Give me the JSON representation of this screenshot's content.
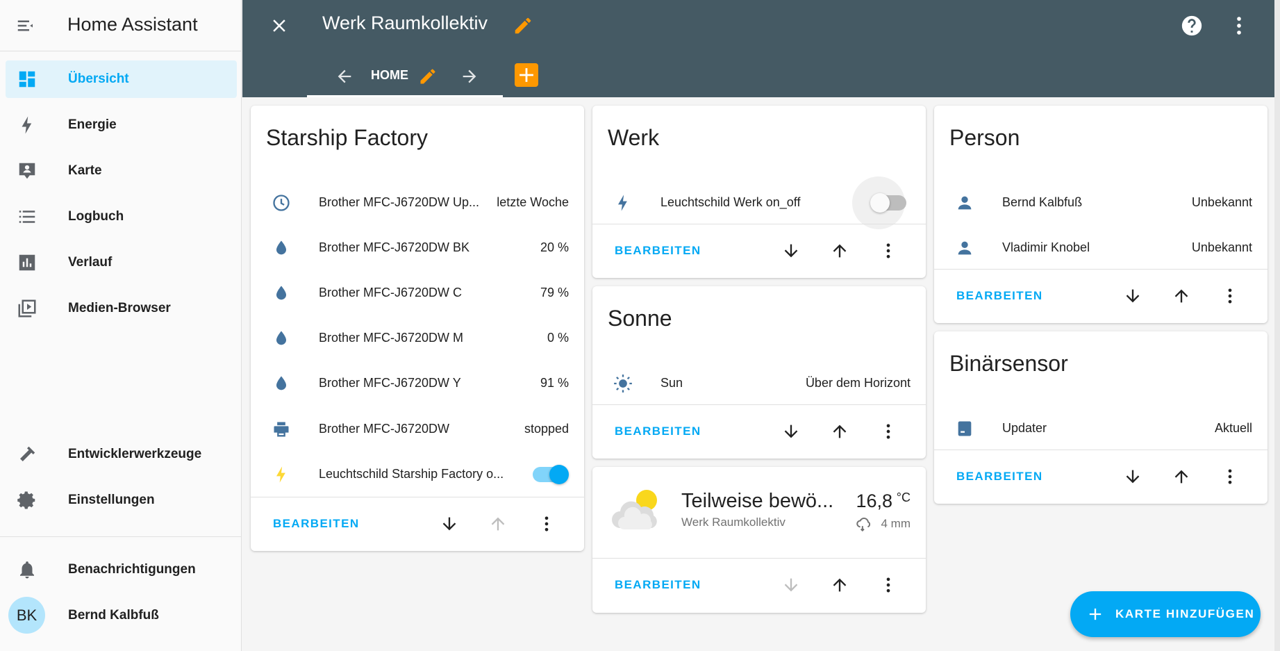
{
  "sidebar": {
    "app_title": "Home Assistant",
    "items": [
      {
        "label": "Übersicht",
        "icon": "dashboard-icon"
      },
      {
        "label": "Energie",
        "icon": "lightning-icon"
      },
      {
        "label": "Karte",
        "icon": "map-icon"
      },
      {
        "label": "Logbuch",
        "icon": "list-icon"
      },
      {
        "label": "Verlauf",
        "icon": "chart-icon"
      },
      {
        "label": "Medien-Browser",
        "icon": "media-icon"
      }
    ],
    "bottom_items": [
      {
        "label": "Entwicklerwerkzeuge",
        "icon": "hammer-icon"
      },
      {
        "label": "Einstellungen",
        "icon": "gear-icon"
      }
    ],
    "notifications_label": "Benachrichtigungen",
    "user": {
      "initials": "BK",
      "name": "Bernd Kalbfuß"
    }
  },
  "header": {
    "title": "Werk Raumkollektiv",
    "tab_label": "HOME"
  },
  "cards": {
    "starship": {
      "title": "Starship Factory",
      "rows": [
        {
          "name": "Brother MFC-J6720DW Up...",
          "state": "letzte Woche",
          "icon": "clock-icon"
        },
        {
          "name": "Brother MFC-J6720DW BK",
          "state": "20 %",
          "icon": "water-drop-icon"
        },
        {
          "name": "Brother MFC-J6720DW C",
          "state": "79 %",
          "icon": "water-drop-icon"
        },
        {
          "name": "Brother MFC-J6720DW M",
          "state": "0 %",
          "icon": "water-drop-icon"
        },
        {
          "name": "Brother MFC-J6720DW Y",
          "state": "91 %",
          "icon": "water-drop-icon"
        },
        {
          "name": "Brother MFC-J6720DW",
          "state": "stopped",
          "icon": "printer-icon"
        },
        {
          "name": "Leuchtschild Starship Factory o...",
          "state": "on",
          "icon": "lightning-icon"
        }
      ]
    },
    "werk": {
      "title": "Werk",
      "rows": [
        {
          "name": "Leuchtschild Werk on_off",
          "state": "off",
          "icon": "lightning-icon"
        }
      ]
    },
    "sonne": {
      "title": "Sonne",
      "rows": [
        {
          "name": "Sun",
          "state": "Über dem Horizont",
          "icon": "sun-icon"
        }
      ]
    },
    "weather": {
      "condition": "Teilweise bewö...",
      "location": "Werk Raumkollektiv",
      "temperature": "16,8",
      "unit": "°C",
      "precipitation": "4 mm"
    },
    "person": {
      "title": "Person",
      "rows": [
        {
          "name": "Bernd Kalbfuß",
          "state": "Unbekannt",
          "icon": "person-icon"
        },
        {
          "name": "Vladimir Knobel",
          "state": "Unbekannt",
          "icon": "person-icon"
        }
      ]
    },
    "binary": {
      "title": "Binärsensor",
      "rows": [
        {
          "name": "Updater",
          "state": "Aktuell",
          "icon": "package-icon"
        }
      ]
    }
  },
  "actions": {
    "edit_label": "BEARBEITEN"
  },
  "fab": {
    "label": "KARTE HINZUFÜGEN"
  },
  "colors": {
    "header_bg": "#455a64",
    "accent": "#03a9f4",
    "edit_orange": "#ff9800",
    "icon_blue": "#44739e",
    "lightning_on": "#fdd835"
  }
}
